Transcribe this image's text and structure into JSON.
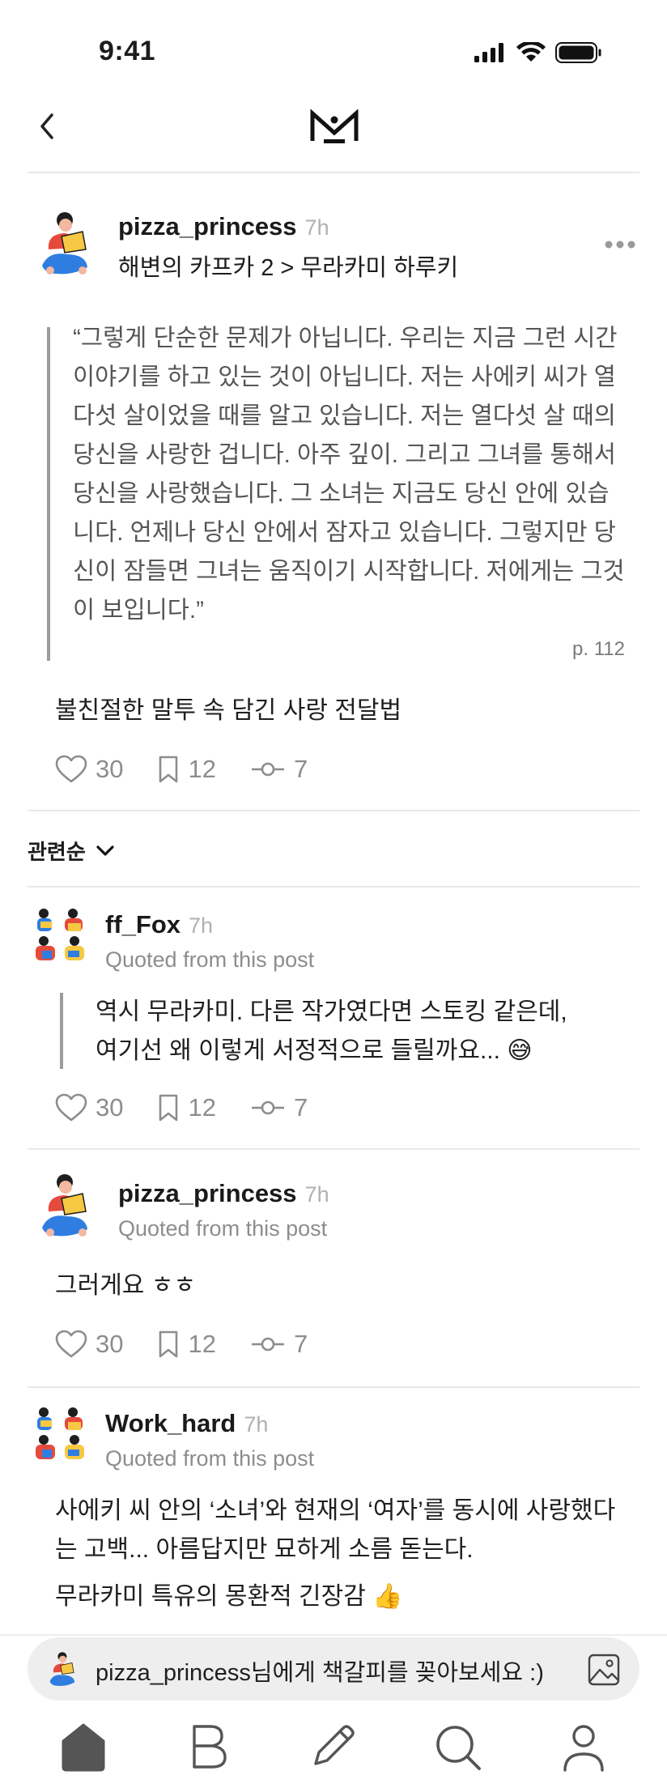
{
  "status": {
    "time": "9:41"
  },
  "post": {
    "username": "pizza_princess",
    "time": "7h",
    "book": "해변의 카프카 2 > 무라카미 하루키",
    "quote_lines": [
      "“그렇게 단순한 문제가 아닙니다. 우리는 지금 그런 시간",
      "이야기를 하고 있는 것이 아닙니다. 저는 사에키 씨가 열",
      "다섯 살이었을 때를 알고 있습니다. 저는 열다섯 살 때의",
      "당신을 사랑한 겁니다. 아주 깊이. 그리고 그녀를 통해서",
      "당신을 사랑했습니다. 그 소녀는 지금도 당신 안에 있습",
      "니다. 언제나 당신 안에서 잠자고 있습니다. 그렇지만 당",
      "신이 잠들면 그녀는 움직이기 시작합니다. 저에게는 그것",
      "이 보입니다.”"
    ],
    "page": "p. 112",
    "caption": "불친절한 말투 속 담긴 사랑 전달법",
    "likes": "30",
    "bookmarks": "12",
    "shares": "7"
  },
  "sort": {
    "label": "관련순"
  },
  "comments": [
    {
      "username": "ff_Fox",
      "time": "7h",
      "quoted": "Quoted from this post",
      "quote_lines": [
        "역시 무라카미. 다른 작가였다면 스토킹 같은데,",
        "여기선 왜 이렇게 서정적으로 들릴까요... 😅"
      ],
      "likes": "30",
      "bookmarks": "12",
      "shares": "7"
    },
    {
      "username": "pizza_princess",
      "time": "7h",
      "quoted": "Quoted from this post",
      "text": "그러게요 ㅎㅎ",
      "likes": "30",
      "bookmarks": "12",
      "shares": "7"
    },
    {
      "username": "Work_hard",
      "time": "7h",
      "quoted": "Quoted from this post",
      "text_lines": [
        "사에키 씨 안의 ‘소녀’와 현재의 ‘여자’를 동시에 사랑했다",
        "는 고백... 아름답지만 묘하게 소름 돋는다."
      ],
      "text2": "무라카미 특유의 몽환적 긴장감 👍"
    }
  ],
  "composer": {
    "placeholder": "pizza_princess님에게 책갈피를 꽂아보세요 :)"
  },
  "colors": {
    "accent_dark": "#1b1b1b",
    "muted": "#8d8d8d",
    "quote_bar": "#9c9c9c",
    "composer_bg": "#eeeeee"
  }
}
